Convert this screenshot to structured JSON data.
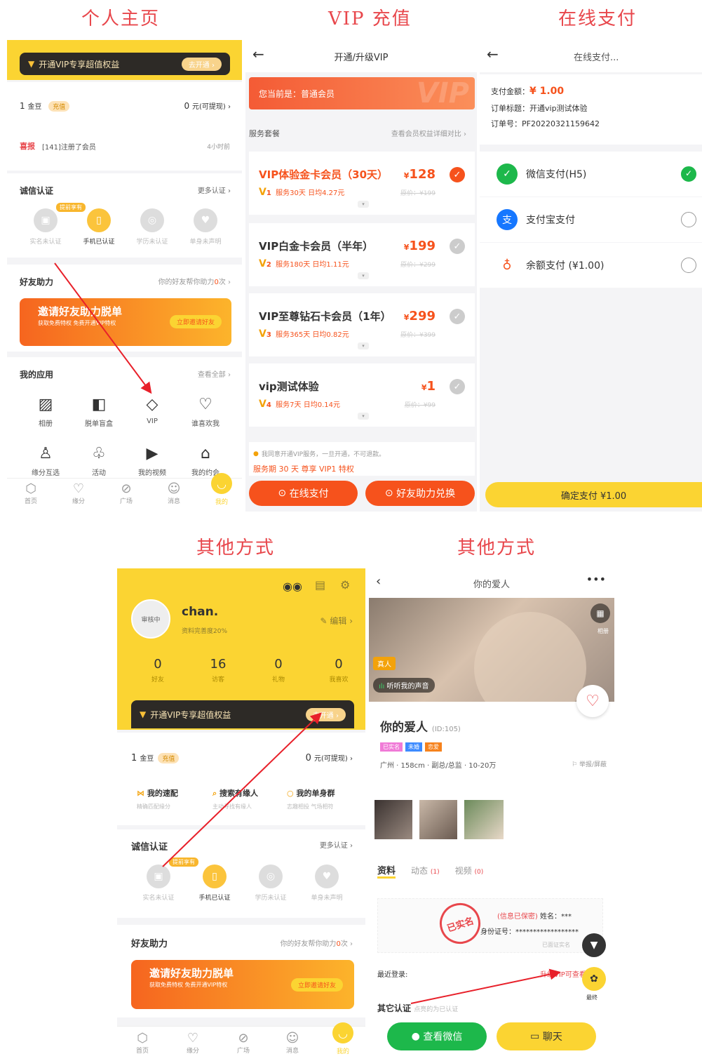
{
  "titles": {
    "profile": "个人主页",
    "vip": "VIP 充值",
    "pay": "在线支付",
    "other1": "其他方式",
    "other2": "其他方式"
  },
  "profile": {
    "vip_banner": "开通VIP专享超值权益",
    "vip_button": "去开通 ›",
    "coins": "1",
    "coins_unit": "金豆",
    "recharge": "充值",
    "cash": "0",
    "cash_unit": "元(可提现) ›",
    "news_brand": "喜报",
    "news_text": "[141]注册了会员",
    "news_time": "4小时前",
    "verify_title": "诚信认证",
    "verify_more": "更多认证 ›",
    "verify_badge": "提前享有",
    "verify_items": [
      "实名未认证",
      "手机已认证",
      "学历未认证",
      "单身未声明"
    ],
    "help_title": "好友助力",
    "help_sub_a": "你的好友帮你助力",
    "help_count": "0",
    "help_sub_b": "次 ›",
    "help_banner": "邀请好友助力脱单",
    "help_banner_sub": "获取免费特权 免费开通VIP特权",
    "help_banner_btn": "立即邀请好友",
    "apps_title": "我的应用",
    "apps_more": "查看全部 ›",
    "apps": [
      "相册",
      "脱单盲盒",
      "VIP",
      "谁喜欢我",
      "缘分互选",
      "活动",
      "我的视频",
      "我的约会"
    ],
    "tabs": [
      "首页",
      "缘分",
      "广场",
      "消息",
      "我的"
    ]
  },
  "vip": {
    "header": "开通/升级VIP",
    "current": "您当前是：普通会员",
    "watermark": "VIP",
    "section": "服务套餐",
    "section_more": "查看会员权益详细对比 ›",
    "packages": [
      {
        "name": "VIP体验金卡会员（30天）",
        "price": "128",
        "level": "1",
        "desc": "服务30天 日均4.27元",
        "orig": "原价：¥199",
        "selected": true
      },
      {
        "name": "VIP白金卡会员（半年）",
        "price": "199",
        "level": "2",
        "desc": "服务180天 日均1.11元",
        "orig": "原价：¥299",
        "selected": false
      },
      {
        "name": "VIP至尊钻石卡会员（1年）",
        "price": "299",
        "level": "3",
        "desc": "服务365天 日均0.82元",
        "orig": "原价：¥399",
        "selected": false
      },
      {
        "name": "vip测试体验",
        "price": "1",
        "level": "4",
        "desc": "服务7天 日均0.14元",
        "orig": "原价：¥99",
        "selected": false
      }
    ],
    "agree": "我同意开通VIP服务，一旦开通，不可退款。",
    "summary": "服务期 30 天 尊享 VIP1 特权",
    "btn_pay": "在线支付",
    "btn_friend": "好友助力兑换"
  },
  "pay": {
    "header": "在线支付...",
    "amount_label": "支付金额：",
    "amount": "¥ 1.00",
    "order_title_label": "订单标题：",
    "order_title": "开通vip测试体验",
    "order_no_label": "订单号：",
    "order_no": "PF20220321159642",
    "methods": [
      "微信支付(H5)",
      "支付宝支付",
      "余额支付 (¥1.00)"
    ],
    "confirm": "确定支付 ¥1.00"
  },
  "me": {
    "name": "chan.",
    "avatar_label": "审核中",
    "completeness": "资料完善度20%",
    "edit": "编辑 ›",
    "stats": [
      {
        "v": "0",
        "l": "好友"
      },
      {
        "v": "16",
        "l": "访客"
      },
      {
        "v": "0",
        "l": "礼物"
      },
      {
        "v": "0",
        "l": "我喜欢"
      }
    ],
    "vip_banner": "开通VIP专享超值权益",
    "vip_button": "去开通 ›",
    "coins": "1",
    "coins_unit": "金豆",
    "recharge": "充值",
    "cash": "0",
    "cash_unit": "元(可提现) ›",
    "features": [
      {
        "t": "我的速配",
        "s": "精确匹配缘分"
      },
      {
        "t": "搜索有缘人",
        "s": "主动寻找有缘人"
      },
      {
        "t": "我的单身群",
        "s": "志趣相投 气场相符"
      }
    ],
    "verify_title": "诚信认证",
    "verify_more": "更多认证 ›",
    "verify_badge": "提前享有",
    "verify_items": [
      "实名未认证",
      "手机已认证",
      "学历未认证",
      "单身未声明"
    ],
    "help_title": "好友助力",
    "help_sub_a": "你的好友帮你助力",
    "help_count": "0",
    "help_sub_b": "次 ›",
    "help_banner": "邀请好友助力脱单",
    "help_banner_sub": "获取免费特权 免费开通VIP特权",
    "help_banner_btn": "立即邀请好友",
    "tabs": [
      "首页",
      "缘分",
      "广场",
      "消息",
      "我的"
    ]
  },
  "detail": {
    "header": "你的爱人",
    "real": "真人",
    "voice": "听听我的声音",
    "album": "相册",
    "name": "你的爱人",
    "id": "(ID:105)",
    "tags": [
      "已实名",
      "未婚",
      "恋爱"
    ],
    "info": "广州 · 158cm · 副总/总监 · 10-20万",
    "report": "举报/屏蔽",
    "tabs": [
      {
        "t": "资料",
        "c": ""
      },
      {
        "t": "动态",
        "c": "(1)"
      },
      {
        "t": "视频",
        "c": "(0)"
      }
    ],
    "secret": "(信息已保密)",
    "name_label": "姓名：***",
    "id_label": "身份证号：******************",
    "verified": "已面证实名",
    "stamp": "已实名",
    "recent": "最近登录:",
    "upgrade": "升级VIP可查看",
    "other_verify": "其它认证",
    "other_verify_sub": "点亮的为已认证",
    "btn_wechat": "查看微信",
    "btn_chat": "聊天",
    "fab_label": "最终"
  },
  "colors": {
    "accent": "#f6521c",
    "yellow": "#fbd432",
    "gold": "#f3a20a",
    "wechat": "#1db84b",
    "alipay": "#1677ff"
  }
}
